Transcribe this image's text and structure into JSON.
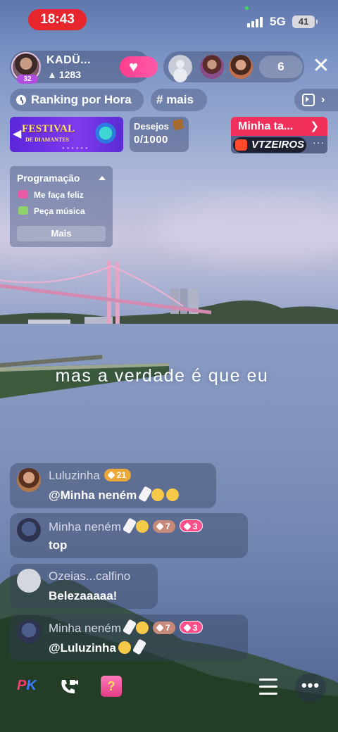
{
  "status_bar": {
    "time": "18:43",
    "network": "5G",
    "battery": "41"
  },
  "host": {
    "name": "KADÜ...",
    "level": "32",
    "likes": "1283"
  },
  "viewers": {
    "count": "6"
  },
  "chips": {
    "ranking": "Ranking por Hora",
    "mais": "mais"
  },
  "festival": {
    "title": "FESTIVAL",
    "subtitle": "DE DIAMANTES"
  },
  "desejos": {
    "label": "Desejos",
    "value": "0/1000"
  },
  "task": {
    "label": "Minha ta...",
    "brand": "VTZEIROS"
  },
  "programacao": {
    "title": "Programação",
    "items": [
      "Me faça feliz",
      "Peça música"
    ],
    "button": "Mais"
  },
  "lyric": "mas a verdade é que eu",
  "chat": [
    {
      "user": "Luluzinha",
      "badge": "21",
      "text": "@Minha neném"
    },
    {
      "user": "Minha neném",
      "badge1": "7",
      "badge2": "3",
      "text": "top"
    },
    {
      "user": "Ozeias...calfino",
      "text": "Belezaaaaa!"
    },
    {
      "user": "Minha neném",
      "badge1": "7",
      "badge2": "3",
      "text": "@Luluzinha"
    }
  ],
  "bottom_bar": {
    "pk": "PK",
    "gift": "?"
  },
  "colors": {
    "time_pill": "#e8262d",
    "follow": "#ff3d8d",
    "task": "#f0305a",
    "festival": "#6a2fe4"
  }
}
